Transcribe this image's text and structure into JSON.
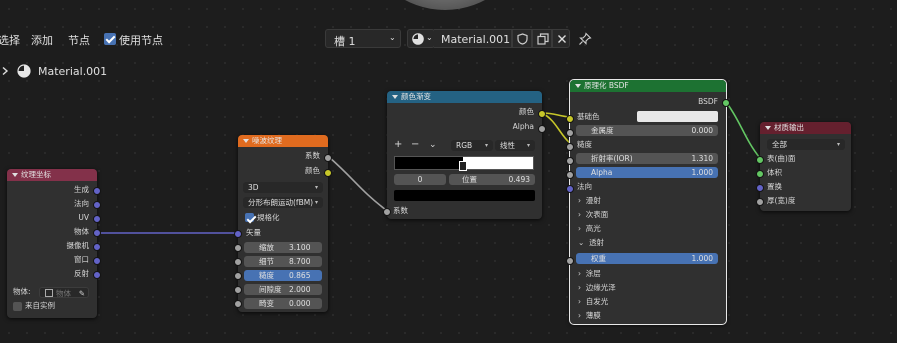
{
  "header": {
    "select_label": "选择",
    "add_label": "添加",
    "node_label": "节点",
    "use_nodes_label": "使用节点",
    "slot_label": "槽 1",
    "material_name": "Material.001"
  },
  "breadcrumb": {
    "label": "Material.001"
  },
  "nodes": {
    "texcoord": {
      "title": "纹理坐标",
      "outputs": [
        "生成",
        "法向",
        "UV",
        "物体",
        "摄像机",
        "窗口",
        "反射"
      ],
      "object_label": "物体:",
      "object_placeholder": "物体",
      "from_instancer": "来自实例"
    },
    "noise": {
      "title": "噪波纹理",
      "outputs": [
        "系数",
        "颜色"
      ],
      "dimension": "3D",
      "type": "分形布朗运动(fBM)",
      "normalize_label": "規格化",
      "vector_label": "矢量",
      "fields": [
        {
          "label": "缩放",
          "value": "3.100"
        },
        {
          "label": "细节",
          "value": "8.700"
        },
        {
          "label": "糙度",
          "value": "0.865"
        },
        {
          "label": "间隙度",
          "value": "2.000"
        },
        {
          "label": "畸变",
          "value": "0.000"
        }
      ]
    },
    "ramp": {
      "title": "颜色渐变",
      "out_color": "颜色",
      "out_alpha": "Alpha",
      "mode": "RGB",
      "interp": "线性",
      "stop_index": "0",
      "pos_label": "位置",
      "pos_value": "0.493",
      "stop_fraction": 0.493,
      "in_factor": "系数"
    },
    "bsdf": {
      "title": "原理化 BSDF",
      "output": "BSDF",
      "base_color": "基础色",
      "metallic_label": "金属度",
      "metallic_value": "0.000",
      "roughness": "糙度",
      "ior_label": "折射率(IOR)",
      "ior_value": "1.310",
      "alpha_label": "Alpha",
      "alpha_value": "1.000",
      "normal": "法向",
      "subsurface": "漫射",
      "subsurface2": "次表面",
      "specular": "高光",
      "transmission": "透射",
      "weight_label": "权重",
      "weight_value": "1.000",
      "coat": "涂层",
      "sheen": "边缘光泽",
      "emission": "自发光",
      "thin_film": "薄膜"
    },
    "output": {
      "title": "材质输出",
      "target": "全部",
      "inputs": [
        "表(曲)面",
        "体积",
        "置换",
        "厚(宽)度"
      ]
    }
  },
  "colors": {
    "texcoord_header": "#83314a",
    "noise_header": "#e06b1f",
    "ramp_header": "#246283",
    "bsdf_header": "#1d7232",
    "output_header": "#65202e",
    "accent_blue": "#4772b3"
  }
}
